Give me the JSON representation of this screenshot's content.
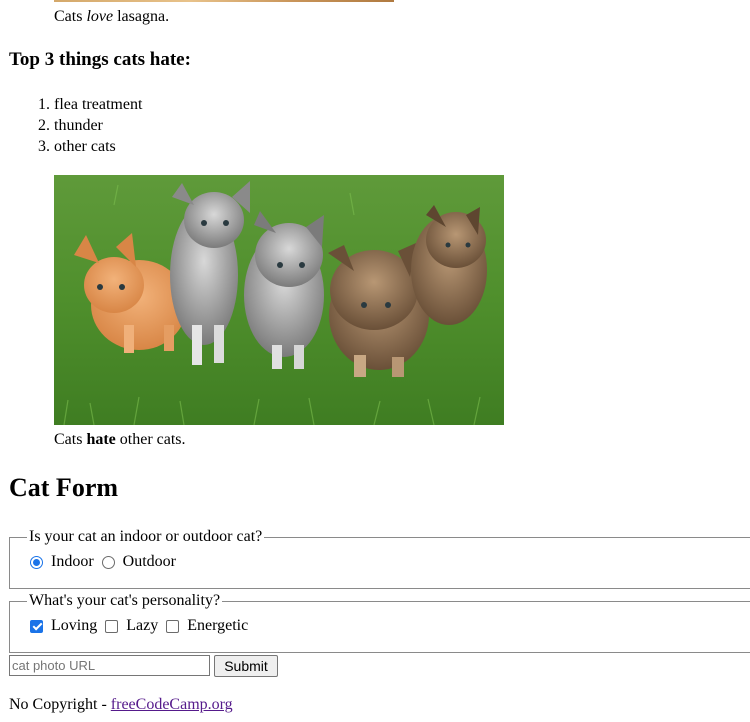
{
  "top_caption": {
    "prefix": "Cats ",
    "emphasis": "love",
    "suffix": " lasagna."
  },
  "hate_section": {
    "heading": "Top 3 things cats hate:",
    "items": [
      "flea treatment",
      "thunder",
      "other cats"
    ]
  },
  "kitten_image": {
    "alt": "Five cats looking around a field."
  },
  "bottom_caption": {
    "prefix": "Cats ",
    "strong": "hate",
    "suffix": " other cats."
  },
  "form": {
    "heading": "Cat Form",
    "location": {
      "legend": "Is your cat an indoor or outdoor cat?",
      "options": [
        {
          "label": "Indoor",
          "checked": true
        },
        {
          "label": "Outdoor",
          "checked": false
        }
      ]
    },
    "personality": {
      "legend": "What's your cat's personality?",
      "options": [
        {
          "label": "Loving",
          "checked": true
        },
        {
          "label": "Lazy",
          "checked": false
        },
        {
          "label": "Energetic",
          "checked": false
        }
      ]
    },
    "url_placeholder": "cat photo URL",
    "submit_label": "Submit"
  },
  "footer": {
    "text": "No Copyright - ",
    "link_text": "freeCodeCamp.org"
  },
  "colors": {
    "accent": "#1a73e8",
    "visited_link": "#551a8b"
  }
}
